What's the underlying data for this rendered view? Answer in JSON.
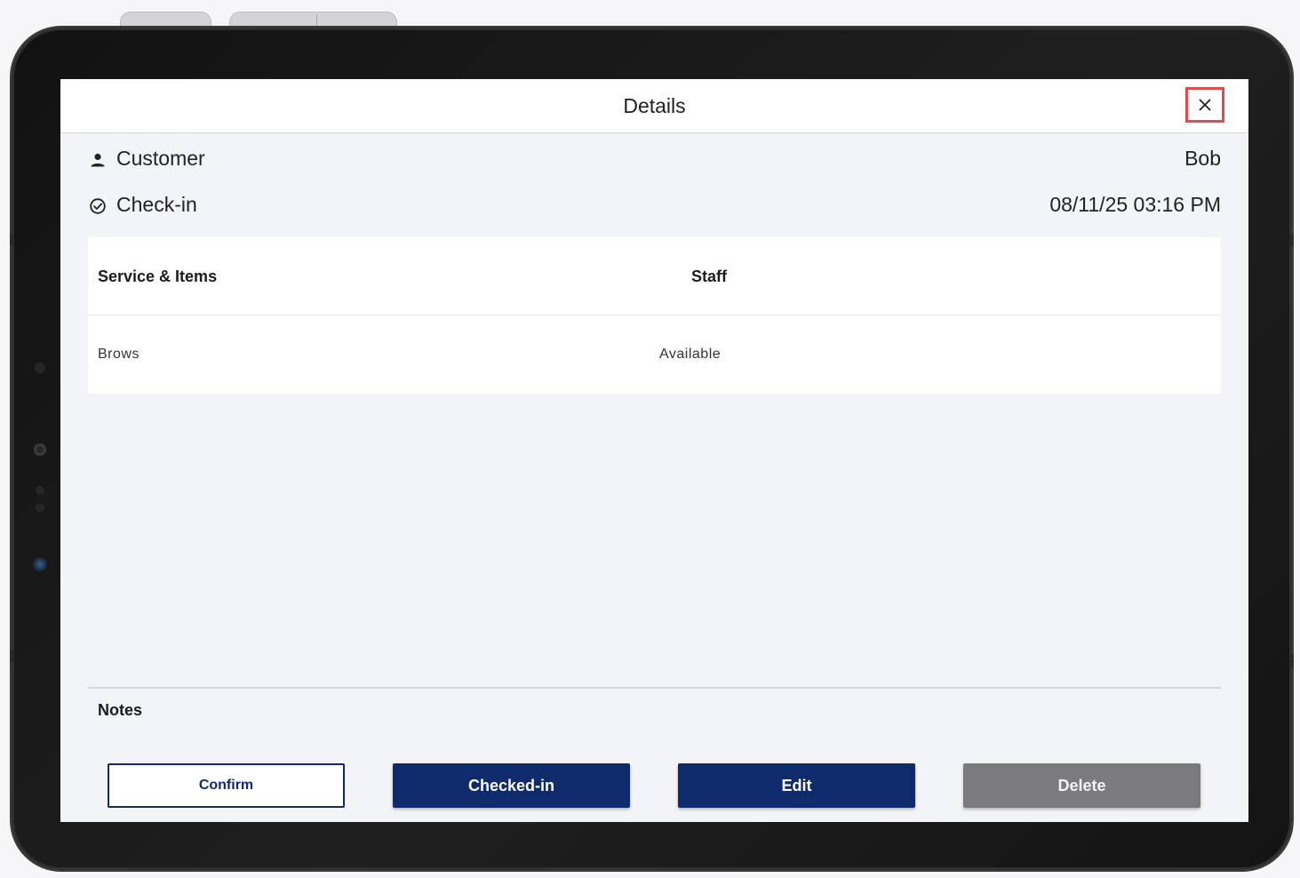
{
  "header": {
    "title": "Details",
    "close_icon": "close-icon"
  },
  "info": {
    "customer_label": "Customer",
    "customer_value": "Bob",
    "customer_icon": "person-icon",
    "checkin_label": "Check-in",
    "checkin_value": "08/11/25 03:16 PM",
    "checkin_icon": "check-circle-icon"
  },
  "table": {
    "columns": [
      "Service & Items",
      "Staff"
    ],
    "rows": [
      {
        "service": "Brows",
        "staff": "Available"
      }
    ]
  },
  "notes": {
    "label": "Notes"
  },
  "actions": {
    "confirm": "Confirm",
    "checked_in": "Checked-in",
    "edit": "Edit",
    "delete": "Delete"
  },
  "colors": {
    "primary": "#102b6b",
    "disabled": "#7b7b7e",
    "highlight": "#e5484d",
    "screen_bg": "#f3f4f8"
  }
}
